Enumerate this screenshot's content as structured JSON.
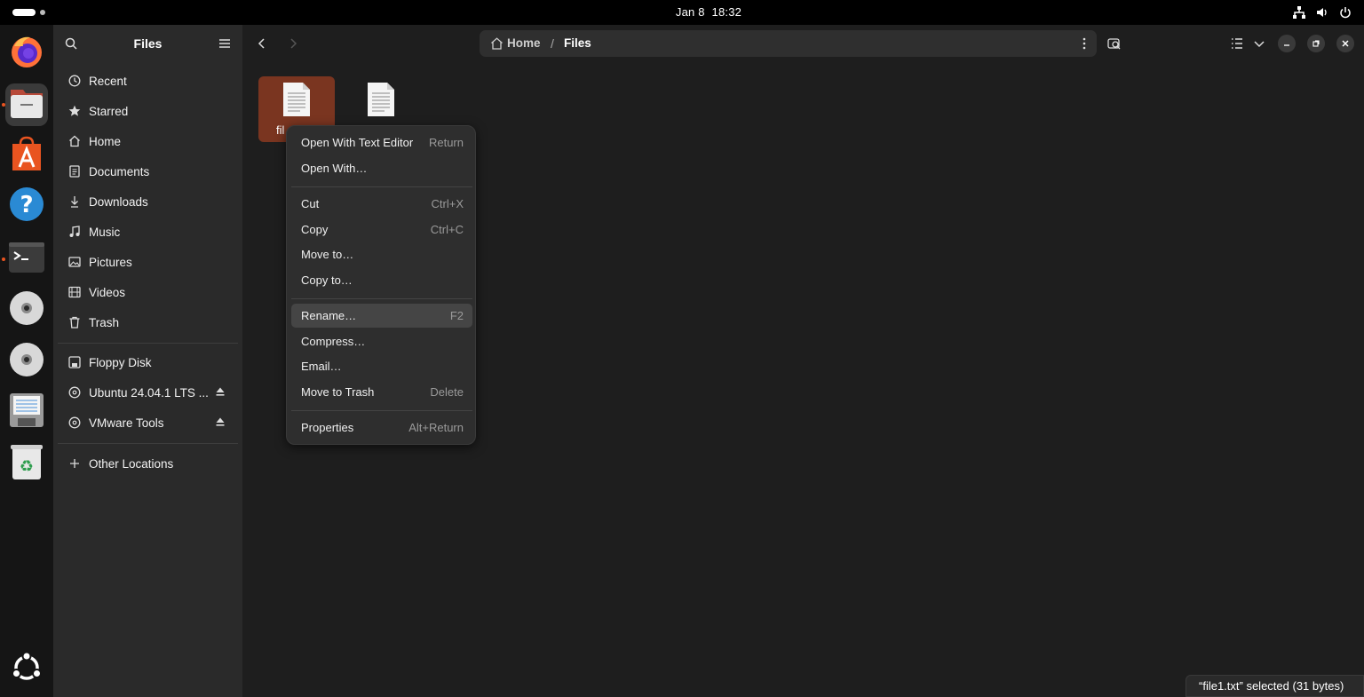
{
  "topbar": {
    "date": "Jan 8",
    "time": "18:32"
  },
  "dock": {
    "items": [
      {
        "name": "Firefox"
      },
      {
        "name": "Files"
      },
      {
        "name": "App Center"
      },
      {
        "name": "Help"
      },
      {
        "name": "Terminal"
      },
      {
        "name": "Disc"
      },
      {
        "name": "Disc"
      },
      {
        "name": "Floppy"
      },
      {
        "name": "Trash"
      },
      {
        "name": "Show Apps"
      }
    ]
  },
  "sidebar": {
    "title": "Files",
    "places": [
      {
        "label": "Recent",
        "icon": "clock-icon"
      },
      {
        "label": "Starred",
        "icon": "star-icon"
      },
      {
        "label": "Home",
        "icon": "home-icon"
      },
      {
        "label": "Documents",
        "icon": "document-icon"
      },
      {
        "label": "Downloads",
        "icon": "download-icon"
      },
      {
        "label": "Music",
        "icon": "music-icon"
      },
      {
        "label": "Pictures",
        "icon": "picture-icon"
      },
      {
        "label": "Videos",
        "icon": "video-icon"
      },
      {
        "label": "Trash",
        "icon": "trash-icon"
      }
    ],
    "devices": [
      {
        "label": "Floppy Disk"
      },
      {
        "label": "Ubuntu 24.04.1 LTS ..."
      },
      {
        "label": "VMware Tools"
      }
    ],
    "other": {
      "label": "Other Locations"
    }
  },
  "path": {
    "home": "Home",
    "separator": "/",
    "current": "Files"
  },
  "files": [
    {
      "name": "fil",
      "selected": true
    },
    {
      "name": "",
      "selected": false
    }
  ],
  "context_menu": {
    "groups": [
      [
        {
          "label": "Open With Text Editor",
          "accel": "Return"
        },
        {
          "label": "Open With…",
          "accel": ""
        }
      ],
      [
        {
          "label": "Cut",
          "accel": "Ctrl+X"
        },
        {
          "label": "Copy",
          "accel": "Ctrl+C"
        },
        {
          "label": "Move to…",
          "accel": ""
        },
        {
          "label": "Copy to…",
          "accel": ""
        }
      ],
      [
        {
          "label": "Rename…",
          "accel": "F2"
        },
        {
          "label": "Compress…",
          "accel": ""
        },
        {
          "label": "Email…",
          "accel": ""
        },
        {
          "label": "Move to Trash",
          "accel": "Delete"
        }
      ],
      [
        {
          "label": "Properties",
          "accel": "Alt+Return"
        }
      ]
    ],
    "highlighted": "Rename…"
  },
  "status": {
    "text": "“file1.txt” selected  (31 bytes)"
  },
  "colors": {
    "accent": "#e95420",
    "selection": "#7a3520"
  }
}
